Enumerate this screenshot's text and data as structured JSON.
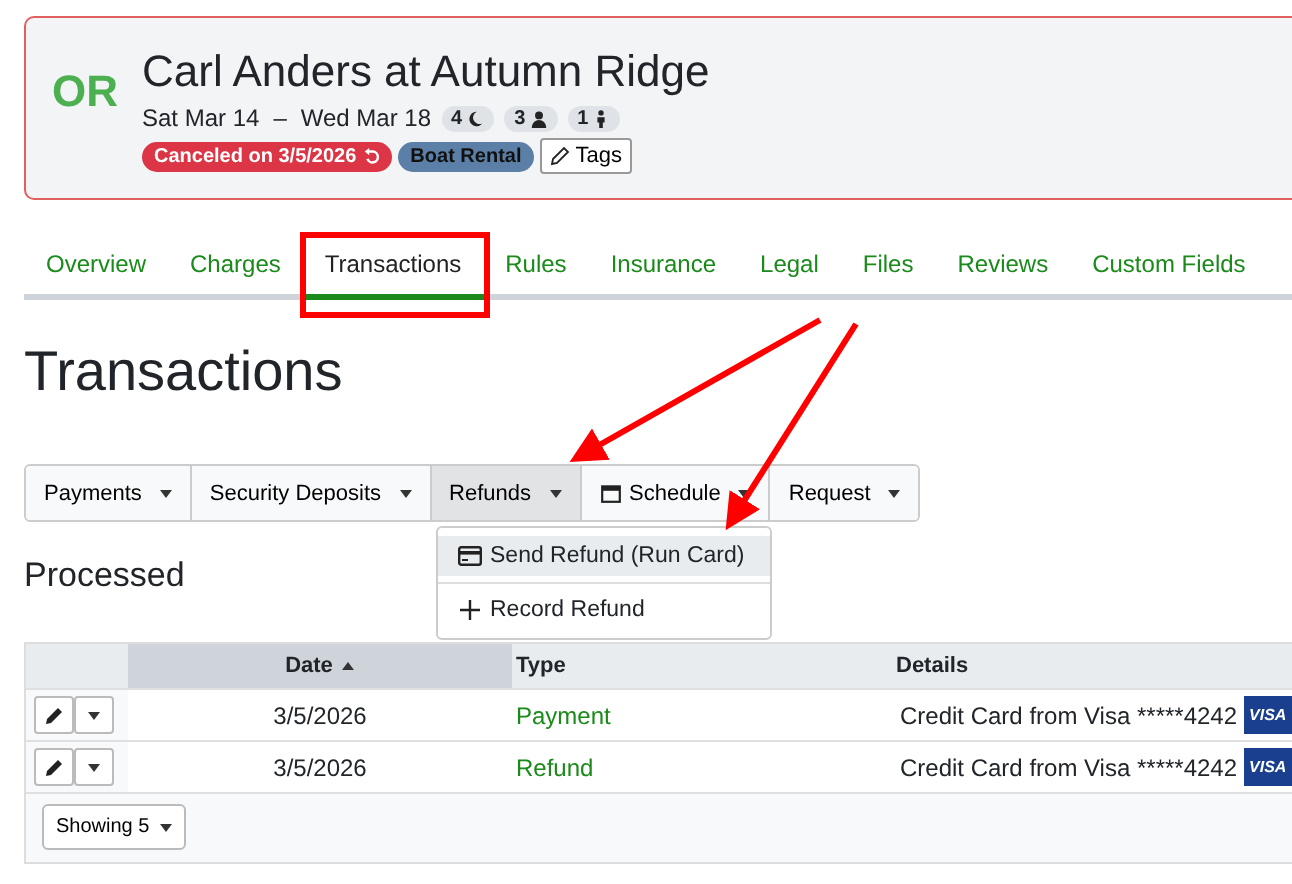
{
  "header": {
    "logo": "OR",
    "title": "Carl Anders at Autumn Ridge",
    "date_start": "Sat Mar 14",
    "date_separator": "–",
    "date_end": "Wed Mar 18",
    "counts": [
      {
        "value": "4",
        "kind": "nights"
      },
      {
        "value": "3",
        "kind": "adults"
      },
      {
        "value": "1",
        "kind": "children"
      }
    ],
    "badges": [
      {
        "label": "Canceled on 3/5/2026",
        "kind": "canceled"
      },
      {
        "label": "Boat Rental",
        "kind": "tag"
      }
    ],
    "tags_button": "Tags"
  },
  "tabs": [
    {
      "label": "Overview",
      "selected": false
    },
    {
      "label": "Charges",
      "selected": false
    },
    {
      "label": "Transactions",
      "selected": true
    },
    {
      "label": "Rules",
      "selected": false
    },
    {
      "label": "Insurance",
      "selected": false
    },
    {
      "label": "Legal",
      "selected": false
    },
    {
      "label": "Files",
      "selected": false
    },
    {
      "label": "Reviews",
      "selected": false
    },
    {
      "label": "Custom Fields",
      "selected": false
    }
  ],
  "page_title": "Transactions",
  "toolbar": [
    {
      "label": "Payments",
      "active": false,
      "kind": "plain"
    },
    {
      "label": "Security Deposits",
      "active": false,
      "kind": "plain"
    },
    {
      "label": "Refunds",
      "active": true,
      "kind": "plain"
    },
    {
      "label": "Schedule",
      "active": false,
      "kind": "calendar"
    },
    {
      "label": "Request",
      "active": false,
      "kind": "plain"
    }
  ],
  "menu": [
    {
      "label": "Send Refund (Run Card)",
      "kind": "card",
      "selected": true
    },
    {
      "label": "Record Refund",
      "kind": "plus",
      "selected": false
    }
  ],
  "section_title": "Processed",
  "table": {
    "columns": [
      {
        "label": "Date",
        "sorted": true
      },
      {
        "label": "Type",
        "sorted": false
      },
      {
        "label": "Details",
        "sorted": false
      }
    ],
    "rows": [
      {
        "date": "3/5/2026",
        "type": "Payment",
        "details": "Credit Card from Visa *****4242",
        "card": "VISA"
      },
      {
        "date": "3/5/2026",
        "type": "Refund",
        "details": "Credit Card from Visa *****4242",
        "card": "VISA"
      }
    ],
    "page_size": "Showing 5"
  }
}
